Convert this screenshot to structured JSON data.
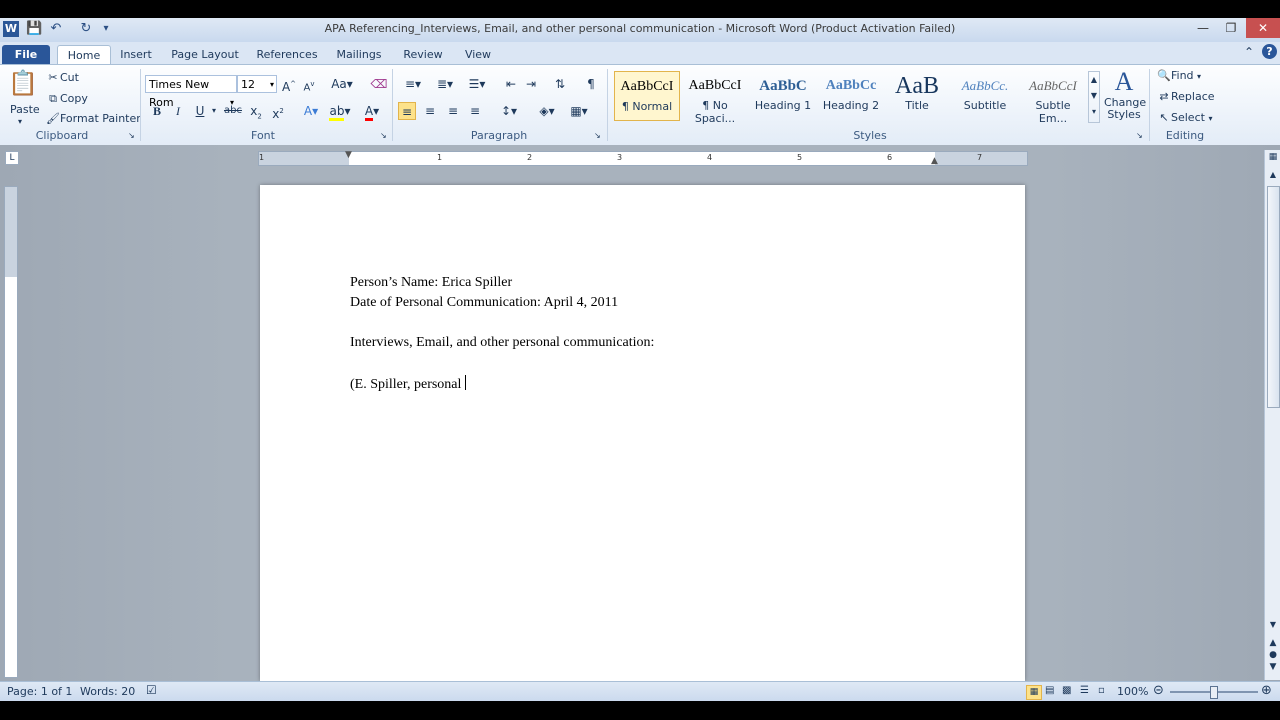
{
  "window": {
    "title": "APA Referencing_Interviews, Email, and other personal communication  -  Microsoft Word (Product Activation Failed)"
  },
  "qat": {
    "icons": [
      "word-app-icon",
      "save-icon",
      "undo-icon",
      "redo-icon",
      "customize-qat-icon"
    ]
  },
  "tabs": [
    {
      "label": "File"
    },
    {
      "label": "Home"
    },
    {
      "label": "Insert"
    },
    {
      "label": "Page Layout"
    },
    {
      "label": "References"
    },
    {
      "label": "Mailings"
    },
    {
      "label": "Review"
    },
    {
      "label": "View"
    }
  ],
  "clipboard": {
    "paste_label": "Paste",
    "cut_label": "Cut",
    "copy_label": "Copy",
    "format_painter_label": "Format Painter",
    "group_label": "Clipboard"
  },
  "font": {
    "font_name": "Times New Rom",
    "font_size": "12",
    "group_label": "Font"
  },
  "paragraph": {
    "group_label": "Paragraph"
  },
  "styles": {
    "group_label": "Styles",
    "items": [
      {
        "sample": "AaBbCcI",
        "name": "¶ Normal"
      },
      {
        "sample": "AaBbCcI",
        "name": "¶ No Spaci..."
      },
      {
        "sample": "AaBbC",
        "name": "Heading 1"
      },
      {
        "sample": "AaBbCc",
        "name": "Heading 2"
      },
      {
        "sample": "AaB",
        "name": "Title"
      },
      {
        "sample": "AaBbCc.",
        "name": "Subtitle"
      },
      {
        "sample": "AaBbCcI",
        "name": "Subtle Em..."
      }
    ],
    "change_styles_label": "Change Styles"
  },
  "editing": {
    "find_label": "Find",
    "replace_label": "Replace",
    "select_label": "Select",
    "group_label": "Editing"
  },
  "ruler": {
    "numbers": [
      "1",
      "1",
      "2",
      "3",
      "4",
      "5",
      "6",
      "7"
    ]
  },
  "document": {
    "line1": "Person’s Name: Erica Spiller",
    "line2": "Date of Personal Communication: April 4, 2011",
    "line3": "Interviews, Email, and other personal communication:",
    "line4": "(E. Spiller, personal"
  },
  "status": {
    "page": "Page: 1 of 1",
    "words": "Words: 20",
    "zoom": "100%"
  },
  "colors": {
    "accent": "#2a5699",
    "highlight": "#ffff00",
    "font_color": "#ff0000"
  }
}
